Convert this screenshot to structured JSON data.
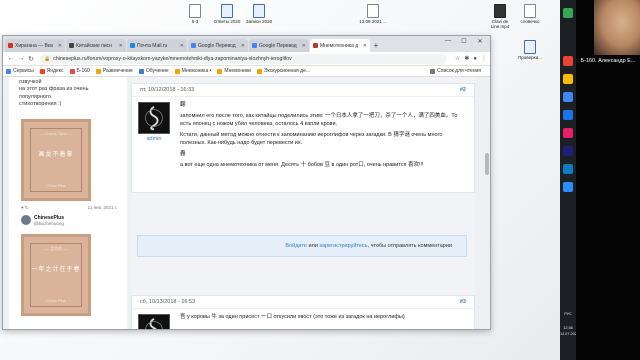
{
  "desktop": {
    "icons": [
      {
        "label": "5-3"
      },
      {
        "label": "Ответы 2020"
      },
      {
        "label": "Записи 2020"
      },
      {
        "label": "13.08.2021 ..."
      },
      {
        "label": "Clavi de Line.mp4"
      },
      {
        "label": "словечко"
      },
      {
        "label": "Проверка..."
      }
    ]
  },
  "browser": {
    "tabs": [
      {
        "title": "Хирагана — Виз",
        "color": "#d93025"
      },
      {
        "title": "Китайские писн",
        "color": "#444444"
      },
      {
        "title": "Почта Mail.ru",
        "color": "#168de2"
      },
      {
        "title": "Google Перевод",
        "color": "#4285f4"
      },
      {
        "title": "Google Перевод",
        "color": "#4285f4"
      },
      {
        "title": "Мнемотехника д",
        "color": "#c0392b",
        "active": true
      }
    ],
    "new_tab": "+",
    "url": "chineseplus.ru/forum/voprosy-o-kitayskom-yazyke/mnemotehniki-dlya-zapominaniya-slozhnyh-ieroglifov",
    "bookmarks": [
      {
        "label": "Сервисы",
        "color": "#4285f4"
      },
      {
        "label": "Яндекс",
        "color": "#fc3f1d"
      },
      {
        "label": "Б-160",
        "color": "#e74c3c"
      },
      {
        "label": "Развлечение",
        "color": "#f0a500"
      },
      {
        "label": "Обучение",
        "color": "#3a7ec6"
      },
      {
        "label": "Мнемоника •",
        "color": "#f0a500"
      },
      {
        "label": "Мнемоники",
        "color": "#f0a500"
      },
      {
        "label": "Экскурсионная де...",
        "color": "#f0a500"
      }
    ],
    "reading_list": "Список для чтения"
  },
  "left": {
    "text_top": [
      "озвучкой",
      "на этот раз фраза из очень популярного",
      "стихотворения :)"
    ],
    "card1": {
      "top": "— Стиль Тана —",
      "main": "画龙不着掌",
      "sub": "China Plus"
    },
    "meta_left": "♥ ↻",
    "meta_right": "11 янв. 2021 г.",
    "author_name": "ChinesePlus",
    "author_handle": "@Buzhehuong",
    "card2": {
      "top": "— 孟浩然 —",
      "main": "一年之计在于春",
      "sub": "China Plus"
    }
  },
  "posts": [
    {
      "date": "пт, 10/12/2018 - 16:33",
      "num": "#2",
      "user": "admin",
      "char1": "翻",
      "p1": "запомнил его после того, как китайцы поделились этим: 一个日本人拿了一把刀，杀了一个人，满了四美血。То есть японец с ножом убил человека, осталось 4 капли крови.",
      "p2": "Кстати, данный метод можно отнести к запоминанию иероглифов через загадки. В 猜字谜 очень много полезных. Как-нибудь надо будет перевести их.",
      "char2": "轟",
      "p3": "а вот еще одна мнемотехника от меня. Десять 十 бобов 豆 в один рот口, очень нравится 喜欢!!!"
    },
    {
      "date": "сб, 10/13/2018 - 16:53",
      "num": "#3",
      "user": "admin",
      "p1": "吾 у коровы 牛 за один присест 一口 откусили хвост (это тоже из загадок на иероглифы)"
    }
  ],
  "login": {
    "link1": "Войдите",
    "mid": "или",
    "link2": "зарегистрируйтесь",
    "tail": ", чтобы отправлять комментарии"
  },
  "scroll_up": "︿",
  "taskbar": {
    "items": [
      {
        "label": "",
        "color": "#34a853"
      },
      {
        "label": "",
        "color": "#ea4335"
      },
      {
        "label": "",
        "color": "#fbbc05"
      },
      {
        "label": "",
        "color": "#4285f4"
      },
      {
        "label": "",
        "color": "#1a73e8"
      },
      {
        "label": "",
        "color": "#e91e63"
      },
      {
        "label": "",
        "color": "#1f1f7a"
      },
      {
        "label": "",
        "color": "#0a7cc8"
      },
      {
        "label": "",
        "color": "#2d8cff"
      }
    ],
    "lang": "РУС",
    "time": "12:36",
    "date": "12.07.2021"
  },
  "video": {
    "name": "Б-160. Александр Е..."
  }
}
